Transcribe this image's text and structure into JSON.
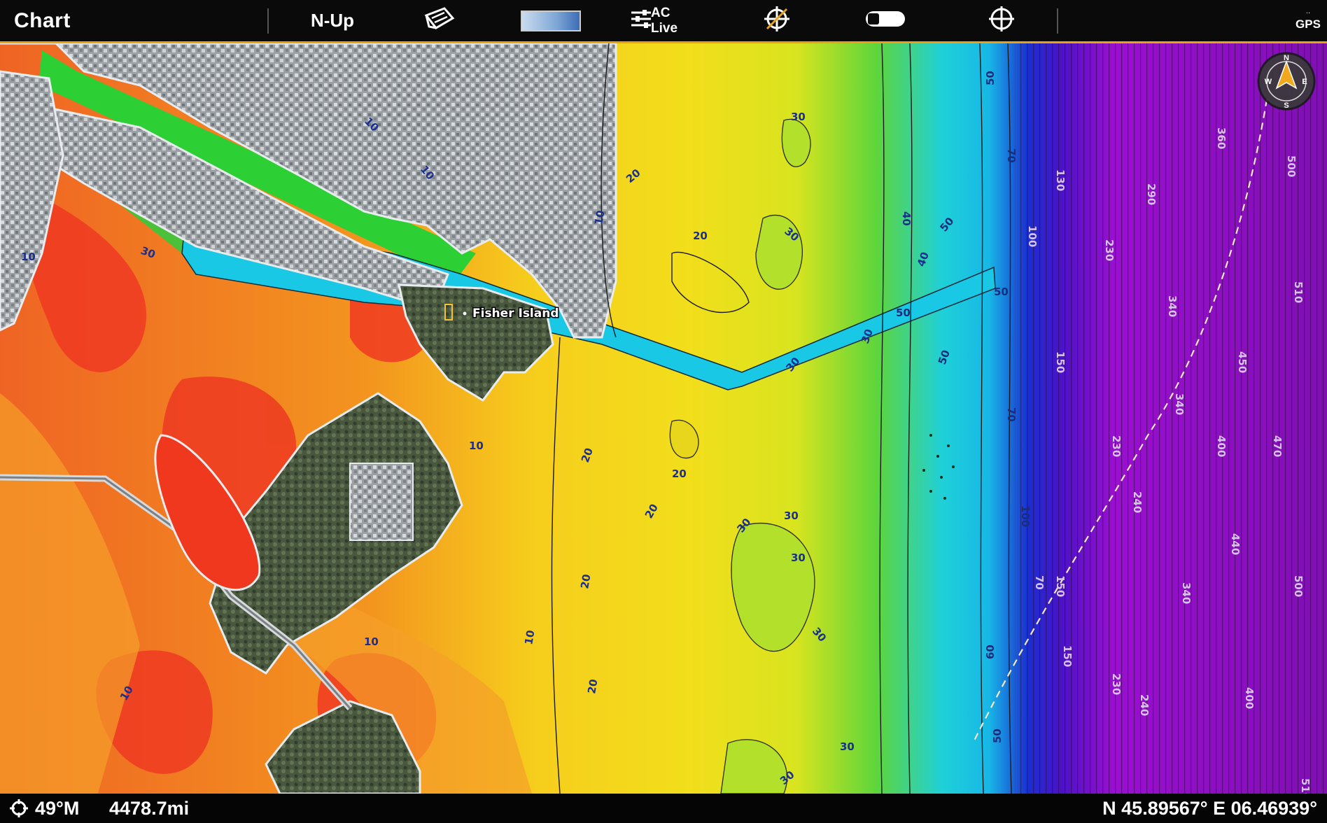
{
  "header": {
    "title": "Chart",
    "orientation_label": "N-Up",
    "ac_live_label": "AC Live",
    "gps_label": "GPS"
  },
  "map": {
    "place_label": "Fisher Island",
    "compass": {
      "n": "N",
      "e": "E",
      "s": "S",
      "w": "W"
    },
    "contour_labels_shallow": [
      "10",
      "20",
      "30"
    ],
    "contour_labels_deep": [
      "40",
      "50",
      "60",
      "70",
      "100",
      "130",
      "150",
      "230",
      "240",
      "290",
      "340",
      "360",
      "400",
      "440",
      "450",
      "470",
      "500",
      "510"
    ]
  },
  "status": {
    "heading": "49°M",
    "distance": "4478.7mi",
    "position": "N 45.89567° E 06.46939°"
  },
  "colors": {
    "accent": "#e8a21a",
    "shallow": "#ef5a22",
    "mid": "#f0d81a",
    "green": "#3ccf3a",
    "channel": "#19c6e6",
    "deep": "#7b0fb8"
  },
  "icons": [
    "chart-settings-icon",
    "color-palette-swatch",
    "ac-live-icon",
    "crosshair-slash-icon",
    "toggle-icon",
    "target-icon",
    "gps-icon",
    "heading-icon",
    "compass-rose-icon"
  ]
}
